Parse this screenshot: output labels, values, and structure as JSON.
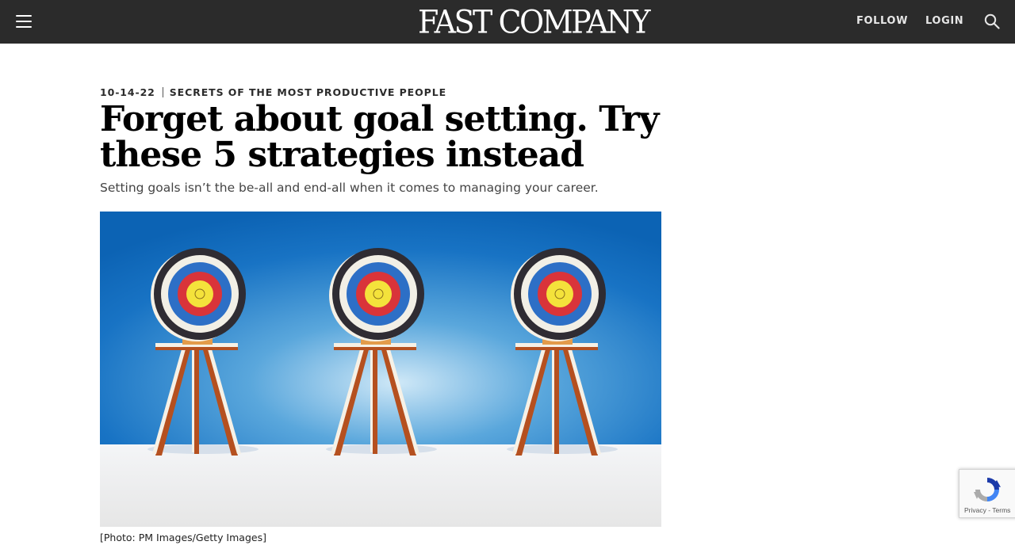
{
  "header": {
    "logo_text": "FAST COMPANY",
    "follow_label": "FOLLOW",
    "login_label": "LOGIN",
    "background_color": "#2b2b2b"
  },
  "article": {
    "date": "10-14-22",
    "section": "SECRETS OF THE MOST PRODUCTIVE PEOPLE",
    "headline": "Forget about goal setting. Try these 5 strategies instead",
    "dek": "Setting goals isn’t the be-all and end-all when it comes to managing your career.",
    "image_caption": "[Photo: PM Images/Getty Images]"
  },
  "recaptcha": {
    "privacy_label": "Privacy",
    "separator": " - ",
    "terms_label": "Terms"
  }
}
